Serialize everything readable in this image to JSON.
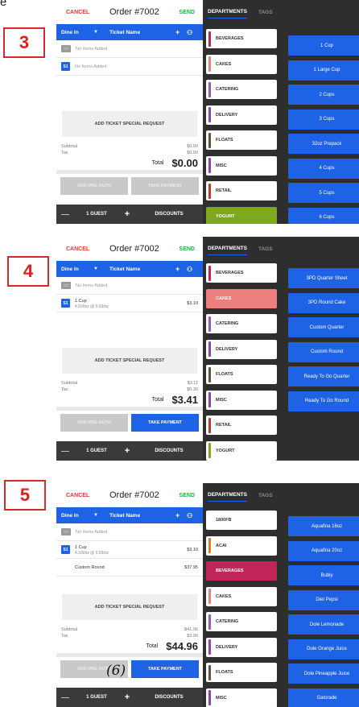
{
  "corner_text": "e",
  "order": {
    "cancel_label": "CANCEL",
    "title": "Order #7002",
    "send_label": "SEND",
    "dine_in_label": "Dine In",
    "ticket_name_label": "Ticket Name",
    "no_items_label": "No Items Added",
    "special_request_label": "ADD TICKET SPECIAL REQUEST",
    "subtotal_label": "Subtotal",
    "tax_label": "Tax",
    "total_label": "Total",
    "pre_auth_label": "ADD PRE-AUTH",
    "take_payment_label": "TAKE PAYMENT",
    "guest_label": "1 GUEST",
    "discounts_label": "DISCOUNTS",
    "seat_label": "S1"
  },
  "departments_tab": "DEPARTMENTS",
  "tags_tab": "TAGS",
  "icons": {
    "chevron": "chevron-down-icon",
    "plus": "plus-icon",
    "add_user": "add-user-icon",
    "minus": "minus-icon"
  },
  "colors": {
    "accent_blue": "#1e63e6",
    "cancel_red": "#e23b3b",
    "send_green": "#2fa84f",
    "label_red": "#e0201c",
    "cakes_selected": "#ef7e7e",
    "beverages_selected": "#c22557",
    "yogurt_selected": "#7fa81f"
  },
  "panels": [
    {
      "step": "3",
      "seat_empty": true,
      "items": [],
      "subtotal": "$0.00",
      "tax": "$0.00",
      "total": "$0.00",
      "payment_enabled": false,
      "departments": [
        {
          "label": "BEVERAGES",
          "color": "#c22557",
          "selected": false
        },
        {
          "label": "CAKES",
          "color": "#ef7e7e",
          "selected": false
        },
        {
          "label": "CATERING",
          "color": "#9b59b6",
          "selected": false
        },
        {
          "label": "DELIVERY",
          "color": "#8e44ad",
          "selected": false
        },
        {
          "label": "FLOATS",
          "color": "#6b4f3a",
          "selected": false
        },
        {
          "label": "MISC",
          "color": "#8e44ad",
          "selected": false
        },
        {
          "label": "RETAIL",
          "color": "#c0392b",
          "selected": false
        },
        {
          "label": "YOGURT",
          "color": "#7fa81f",
          "selected": true
        }
      ],
      "products": [
        "1 Cup",
        "1 Large Cup",
        "2 Cups",
        "3 Cups",
        "32oz Prepack",
        "4 Cups",
        "5 Cups",
        "6 Cups"
      ]
    },
    {
      "step": "4",
      "seat_empty": false,
      "items": [
        {
          "name": "1 Cup",
          "detail": "4.500oz @ 0.69/oz",
          "price": "$3.10"
        }
      ],
      "subtotal": "$3.11",
      "tax": "$0.30",
      "total": "$3.41",
      "payment_enabled": true,
      "departments": [
        {
          "label": "BEVERAGES",
          "color": "#c22557",
          "selected": false
        },
        {
          "label": "CAKES",
          "color": "#ef7e7e",
          "selected": true
        },
        {
          "label": "CATERING",
          "color": "#9b59b6",
          "selected": false
        },
        {
          "label": "DELIVERY",
          "color": "#8e44ad",
          "selected": false
        },
        {
          "label": "FLOATS",
          "color": "#6b4f3a",
          "selected": false
        },
        {
          "label": "MISC",
          "color": "#8e44ad",
          "selected": false
        },
        {
          "label": "RETAIL",
          "color": "#c0392b",
          "selected": false
        },
        {
          "label": "YOGURT",
          "color": "#7fa81f",
          "selected": false
        }
      ],
      "products": [
        "3PD Quarter Sheet",
        "3PD Round Cake",
        "Custom Quarter",
        "Custom Round",
        "Ready To Go Quarter",
        "Ready To Go Round"
      ]
    },
    {
      "step": "5",
      "seat_empty": false,
      "items": [
        {
          "name": "1 Cup",
          "detail": "4.500oz @ 0.69/oz",
          "price": "$3.10"
        },
        {
          "name": "Custom Round",
          "detail": "",
          "price": "$37.95"
        }
      ],
      "subtotal": "$41.06",
      "tax": "$3.90",
      "total": "$44.96",
      "payment_enabled": true,
      "handwritten_note": "(6)",
      "departments": [
        {
          "label": "1800FB",
          "color": "#ffffff",
          "selected": false
        },
        {
          "label": "ACAI",
          "color": "#e07b2a",
          "selected": false
        },
        {
          "label": "BEVERAGES",
          "color": "#c22557",
          "selected": true
        },
        {
          "label": "CAKES",
          "color": "#ef7e7e",
          "selected": false
        },
        {
          "label": "CATERING",
          "color": "#9b59b6",
          "selected": false
        },
        {
          "label": "DELIVERY",
          "color": "#8e44ad",
          "selected": false
        },
        {
          "label": "FLOATS",
          "color": "#6b4f3a",
          "selected": false
        },
        {
          "label": "MISC",
          "color": "#8e44ad",
          "selected": false
        }
      ],
      "products": [
        "Aquafina 16oz",
        "Aquafina 20oz",
        "Bubly",
        "Diet Pepsi",
        "Dole Lemonade",
        "Dole Orange Juice",
        "Dole Pineapple Juice",
        "Gatorade"
      ]
    }
  ]
}
